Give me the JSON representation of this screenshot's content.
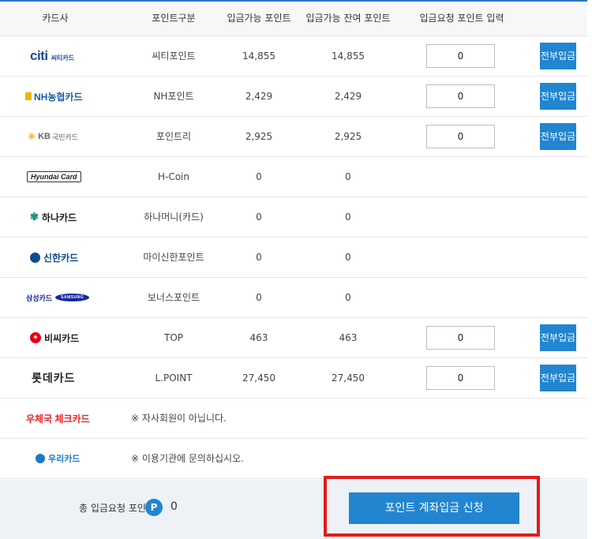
{
  "header": {
    "col_card": "카드사",
    "col_type": "포인트구분",
    "col_available": "입금가능 포인트",
    "col_remaining": "입금가능 잔여 포인트",
    "col_request": "입금요청 포인트 입력"
  },
  "rows": [
    {
      "card": "citi 씨티카드",
      "logo_main": "citi",
      "logo_sub": "씨티카드",
      "point_type": "씨티포인트",
      "available": "14,855",
      "remaining": "14,855",
      "input_value": "0",
      "button": "전부입금"
    },
    {
      "card": "NH농협카드",
      "logo_main": "NH농협카드",
      "point_type": "NH포인트",
      "available": "2,429",
      "remaining": "2,429",
      "input_value": "0",
      "button": "전부입금"
    },
    {
      "card": "KB국민카드",
      "logo_main": "KB",
      "logo_sub": "국민카드",
      "point_type": "포인트리",
      "available": "2,925",
      "remaining": "2,925",
      "input_value": "0",
      "button": "전부입금"
    },
    {
      "card": "Hyundai Card",
      "logo_main": "Hyundai Card",
      "point_type": "H-Coin",
      "available": "0",
      "remaining": "0"
    },
    {
      "card": "하나카드",
      "logo_main": "하나카드",
      "point_type": "하나머니(카드)",
      "available": "0",
      "remaining": "0"
    },
    {
      "card": "신한카드",
      "logo_main": "신한카드",
      "point_type": "마이신한포인트",
      "available": "0",
      "remaining": "0"
    },
    {
      "card": "삼성카드",
      "logo_main": "삼성카드",
      "logo_sub": "SAMSUNG",
      "point_type": "보너스포인트",
      "available": "0",
      "remaining": "0"
    },
    {
      "card": "비씨카드",
      "logo_main": "비씨카드",
      "point_type": "TOP",
      "available": "463",
      "remaining": "463",
      "input_value": "0",
      "button": "전부입금"
    },
    {
      "card": "롯데카드",
      "logo_main": "롯데카드",
      "point_type": "L.POINT",
      "available": "27,450",
      "remaining": "27,450",
      "input_value": "0",
      "button": "전부입금"
    },
    {
      "card": "우체국 체크카드",
      "logo_main": "우체국 체크카드",
      "notice": "※ 자사회원이 아닙니다."
    },
    {
      "card": "우리카드",
      "logo_main": "우리카드",
      "notice": "※ 이용기관에 문의하십시오."
    }
  ],
  "footer": {
    "total_label": "총 입금요청 포인트",
    "badge": "P",
    "total_value": "0",
    "submit_label": "포인트 계좌입금 신청"
  },
  "colors": {
    "accent": "#2285d0",
    "highlight": "#e21b1b",
    "citi_blue": "#1a4a9c",
    "citi_red": "#e6242b",
    "nh_blue": "#1b5fa8",
    "nh_yellow": "#f2b600",
    "kb_yellow": "#f0b31c",
    "hana_green": "#13927e",
    "shinhan_blue": "#0a4a8f",
    "samsung_blue": "#1428a0",
    "bc_red": "#e60012",
    "post_red": "#e6242b",
    "woori_blue": "#1c78c8"
  }
}
